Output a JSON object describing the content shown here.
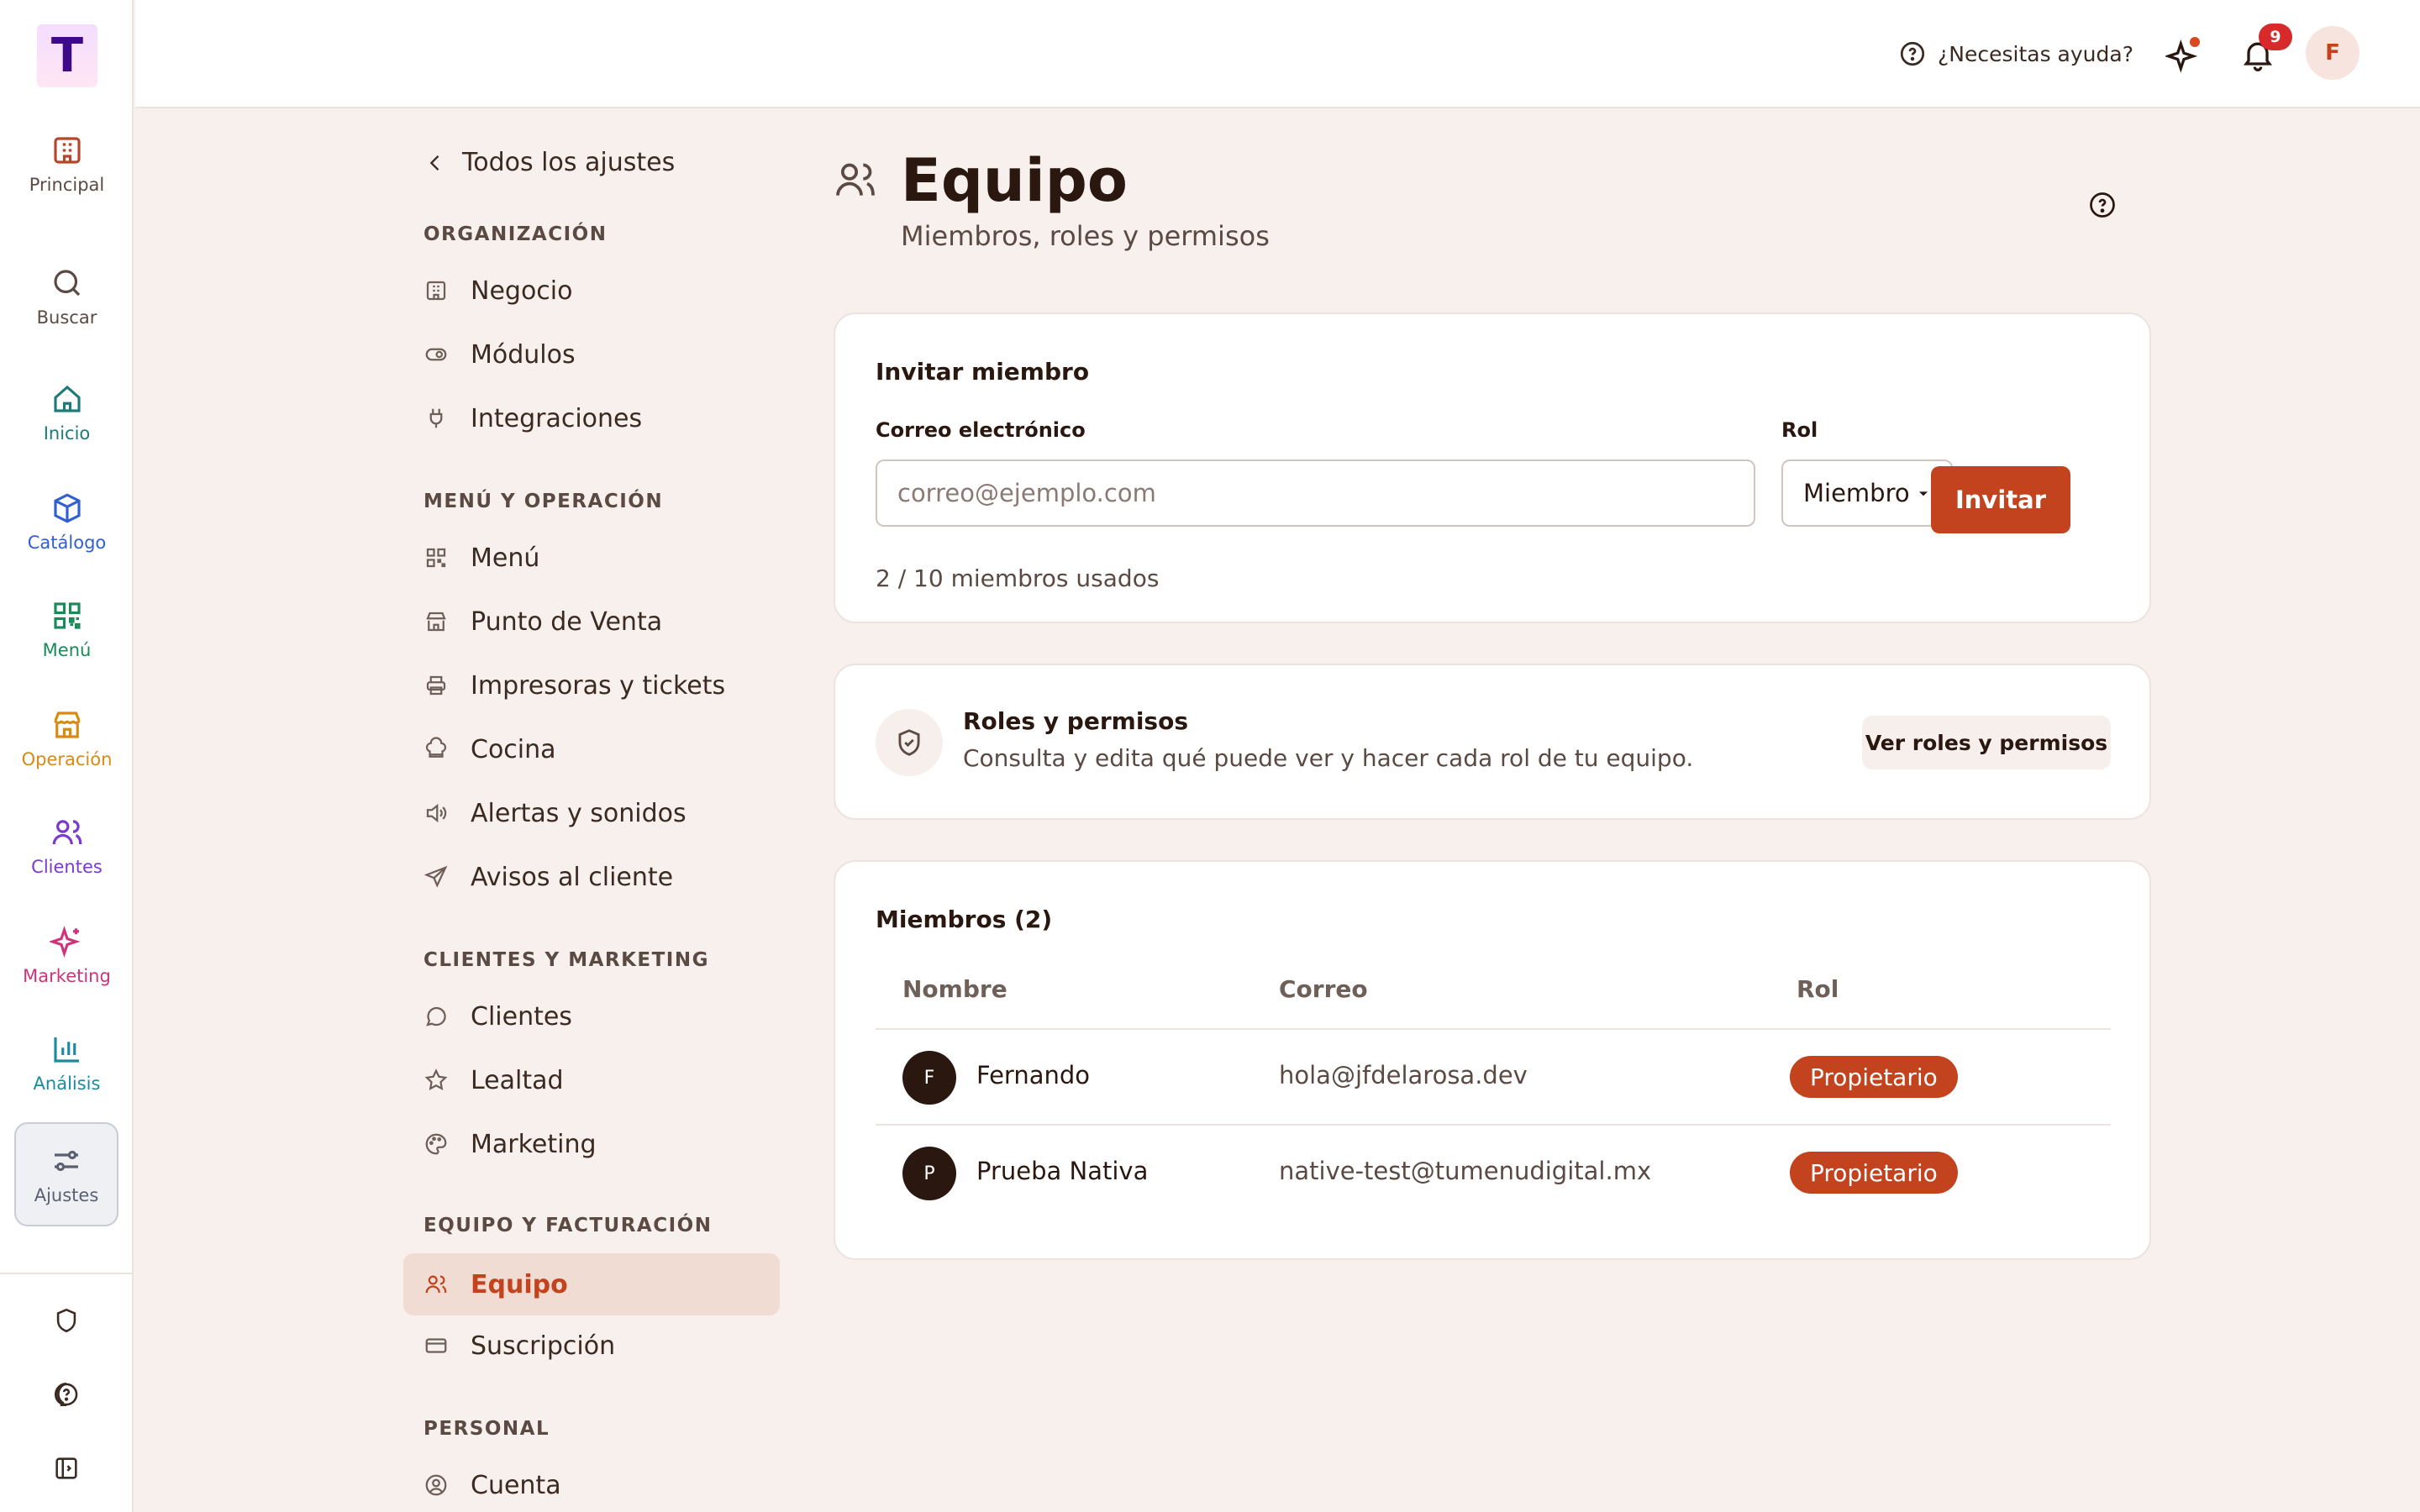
{
  "brand": {
    "logo_letter": "T",
    "logo_color": "#3d0b8a"
  },
  "rail": {
    "items": [
      {
        "label": "Principal",
        "icon": "building-icon",
        "color": "#b5462a"
      },
      {
        "label": "Buscar",
        "icon": "search-icon",
        "color": "#5b4a43"
      },
      {
        "label": "Inicio",
        "icon": "home-icon",
        "color": "#1e7a7a"
      },
      {
        "label": "Catálogo",
        "icon": "box-icon",
        "color": "#2f5fd0"
      },
      {
        "label": "Menú",
        "icon": "qr-code-icon",
        "color": "#1a8a5a"
      },
      {
        "label": "Operación",
        "icon": "store-icon",
        "color": "#d98a14"
      },
      {
        "label": "Clientes",
        "icon": "users-icon",
        "color": "#7a3ad0"
      },
      {
        "label": "Marketing",
        "icon": "sparkles-icon",
        "color": "#d0337a"
      },
      {
        "label": "Análisis",
        "icon": "bar-chart-icon",
        "color": "#1a8aa0"
      },
      {
        "label": "Ajustes",
        "icon": "sliders-icon",
        "color": "#5b6070"
      }
    ],
    "footer": [
      "shield-icon",
      "help-circle-icon",
      "panel-toggle-icon"
    ]
  },
  "topbar": {
    "help_label": "¿Necesitas ayuda?",
    "notifications_count": "9",
    "avatar_initial": "F"
  },
  "settings_nav": {
    "back_label": "Todos los ajustes",
    "sections": [
      {
        "title": "ORGANIZACIÓN",
        "items": [
          "Negocio",
          "Módulos",
          "Integraciones"
        ]
      },
      {
        "title": "MENÚ Y OPERACIÓN",
        "items": [
          "Menú",
          "Punto de Venta",
          "Impresoras y tickets",
          "Cocina",
          "Alertas y sonidos",
          "Avisos al cliente"
        ]
      },
      {
        "title": "CLIENTES Y MARKETING",
        "items": [
          "Clientes",
          "Lealtad",
          "Marketing"
        ]
      },
      {
        "title": "EQUIPO Y FACTURACIÓN",
        "items": [
          "Equipo",
          "Suscripción"
        ]
      },
      {
        "title": "PERSONAL",
        "items": [
          "Cuenta"
        ]
      }
    ],
    "active": "Equipo"
  },
  "page": {
    "title": "Equipo",
    "subtitle": "Miembros, roles y permisos"
  },
  "invite": {
    "title": "Invitar miembro",
    "email_label": "Correo electrónico",
    "email_placeholder": "correo@ejemplo.com",
    "role_label": "Rol",
    "role_value": "Miembro",
    "button": "Invitar",
    "usage": "2 / 10 miembros usados"
  },
  "roles": {
    "title": "Roles y permisos",
    "description": "Consulta y edita qué puede ver y hacer cada rol de tu equipo.",
    "button": "Ver roles y permisos"
  },
  "members": {
    "title": "Miembros (2)",
    "columns": [
      "Nombre",
      "Correo",
      "Rol"
    ],
    "rows": [
      {
        "initial": "F",
        "name": "Fernando",
        "email": "hola@jfdelarosa.dev",
        "role": "Propietario"
      },
      {
        "initial": "P",
        "name": "Prueba Nativa",
        "email": "native-test@tumenudigital.mx",
        "role": "Propietario"
      }
    ]
  },
  "colors": {
    "accent": "#c2431e",
    "background": "#f7f0ed"
  }
}
